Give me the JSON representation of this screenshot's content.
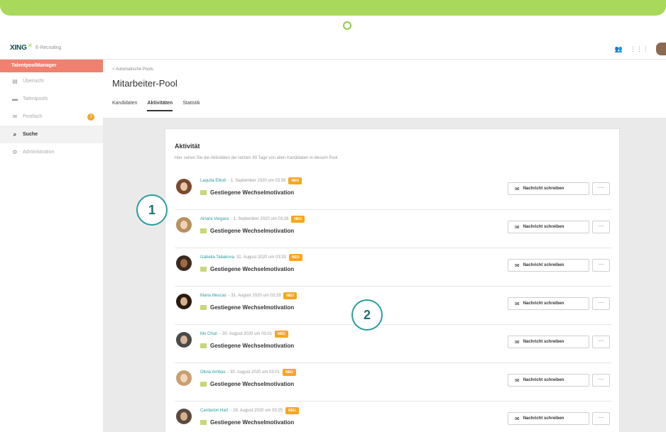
{
  "header": {
    "logo_brand": "XING",
    "logo_sub": "E-Recruiting",
    "icon_people": "people-icon",
    "icon_grid": "grid-icon"
  },
  "sidebar": {
    "section_title": "TalentpoolManager",
    "items": [
      {
        "label": "Übersicht",
        "icon": "overview-icon",
        "glyph": "▤"
      },
      {
        "label": "Talentpools",
        "icon": "folder-icon",
        "glyph": "▬"
      },
      {
        "label": "Postfach",
        "icon": "mail-icon",
        "glyph": "✉",
        "badge": "3"
      },
      {
        "label": "Suche",
        "icon": "search-icon",
        "glyph": "⌕"
      },
      {
        "label": "Administration",
        "icon": "gear-icon",
        "glyph": "⚙"
      }
    ]
  },
  "page": {
    "breadcrumb": "< Automatische Pools",
    "title": "Mitarbeiter-Pool",
    "tabs": [
      "Kandidaten",
      "Aktivitäten",
      "Statistik"
    ]
  },
  "card": {
    "title": "Aktivität",
    "subtitle": "Hier sehen Sie die Aktivitäten der letzten 90 Tage von allen Kandidaten in diesem Pool.",
    "new_badge": "NEU",
    "activity_label": "Gestiegene Wechselmotivation",
    "message_button": "Nachricht schreiben",
    "more_button": "···",
    "rows": [
      {
        "name": "Laquita Elliott",
        "date": "- 1. September 2020 um 03:39"
      },
      {
        "name": "Ainara Vergara",
        "date": "- 1. September 2020 um 03:28"
      },
      {
        "name": "Izabella Tabakova",
        "date": "31. August 2020 um 03:33"
      },
      {
        "name": "Maria Illescas",
        "date": "- 31. August 2020 um 03:29"
      },
      {
        "name": "Mo Chun",
        "date": "- 30. August 2020 um 03:01"
      },
      {
        "name": "Olivia Arribas",
        "date": "- 30. August 2020 um 03:01"
      },
      {
        "name": "Cardarion Hart",
        "date": "- 29. August 2020 um 03:25"
      }
    ]
  },
  "markers": [
    "1",
    "2"
  ],
  "colors": {
    "accent_green": "#a8d95a",
    "teal": "#2a9d9d",
    "badge_orange": "#f5a623",
    "sidebar_head": "#f08070"
  }
}
